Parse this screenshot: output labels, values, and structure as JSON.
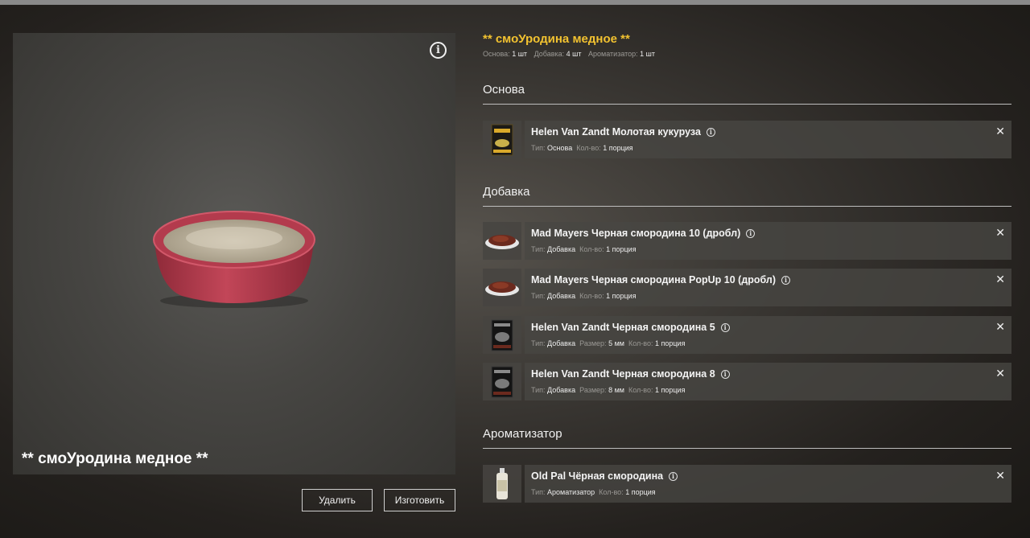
{
  "recipe": {
    "title": "** смоУродина медное **",
    "summary": [
      {
        "label": "Основа:",
        "value": "1 шт"
      },
      {
        "label": "Добавка:",
        "value": "4 шт"
      },
      {
        "label": "Ароматизатор:",
        "value": "1 шт"
      }
    ]
  },
  "preview": {
    "title": "** смоУродина медное **",
    "info_icon": "info-icon"
  },
  "buttons": {
    "delete": "Удалить",
    "craft": "Изготовить"
  },
  "sections": {
    "base": "Основа",
    "additive": "Добавка",
    "flavor": "Ароматизатор"
  },
  "items": {
    "base": [
      {
        "name": "Helen Van Zandt Молотая кукуруза",
        "meta": [
          {
            "label": "Тип:",
            "value": "Основа"
          },
          {
            "label": "Кол-во:",
            "value": "1 порция"
          }
        ]
      }
    ],
    "additive": [
      {
        "name": "Mad Mayers Черная смородина 10 (дробл)",
        "meta": [
          {
            "label": "Тип:",
            "value": "Добавка"
          },
          {
            "label": "Кол-во:",
            "value": "1 порция"
          }
        ]
      },
      {
        "name": "Mad Mayers Черная смородина PopUp 10 (дробл)",
        "meta": [
          {
            "label": "Тип:",
            "value": "Добавка"
          },
          {
            "label": "Кол-во:",
            "value": "1 порция"
          }
        ]
      },
      {
        "name": "Helen Van Zandt Черная смородина 5",
        "meta": [
          {
            "label": "Тип:",
            "value": "Добавка"
          },
          {
            "label": "Размер:",
            "value": "5 мм"
          },
          {
            "label": "Кол-во:",
            "value": "1 порция"
          }
        ]
      },
      {
        "name": "Helen Van Zandt Черная смородина 8",
        "meta": [
          {
            "label": "Тип:",
            "value": "Добавка"
          },
          {
            "label": "Размер:",
            "value": "8 мм"
          },
          {
            "label": "Кол-во:",
            "value": "1 порция"
          }
        ]
      }
    ],
    "flavor": [
      {
        "name": "Old Pal Чёрная смородина",
        "meta": [
          {
            "label": "Тип:",
            "value": "Ароматизатор"
          },
          {
            "label": "Кол-во:",
            "value": "1 порция"
          }
        ]
      }
    ]
  },
  "colors": {
    "accent_title": "#f2c230",
    "bowl": "#b23a4c"
  }
}
